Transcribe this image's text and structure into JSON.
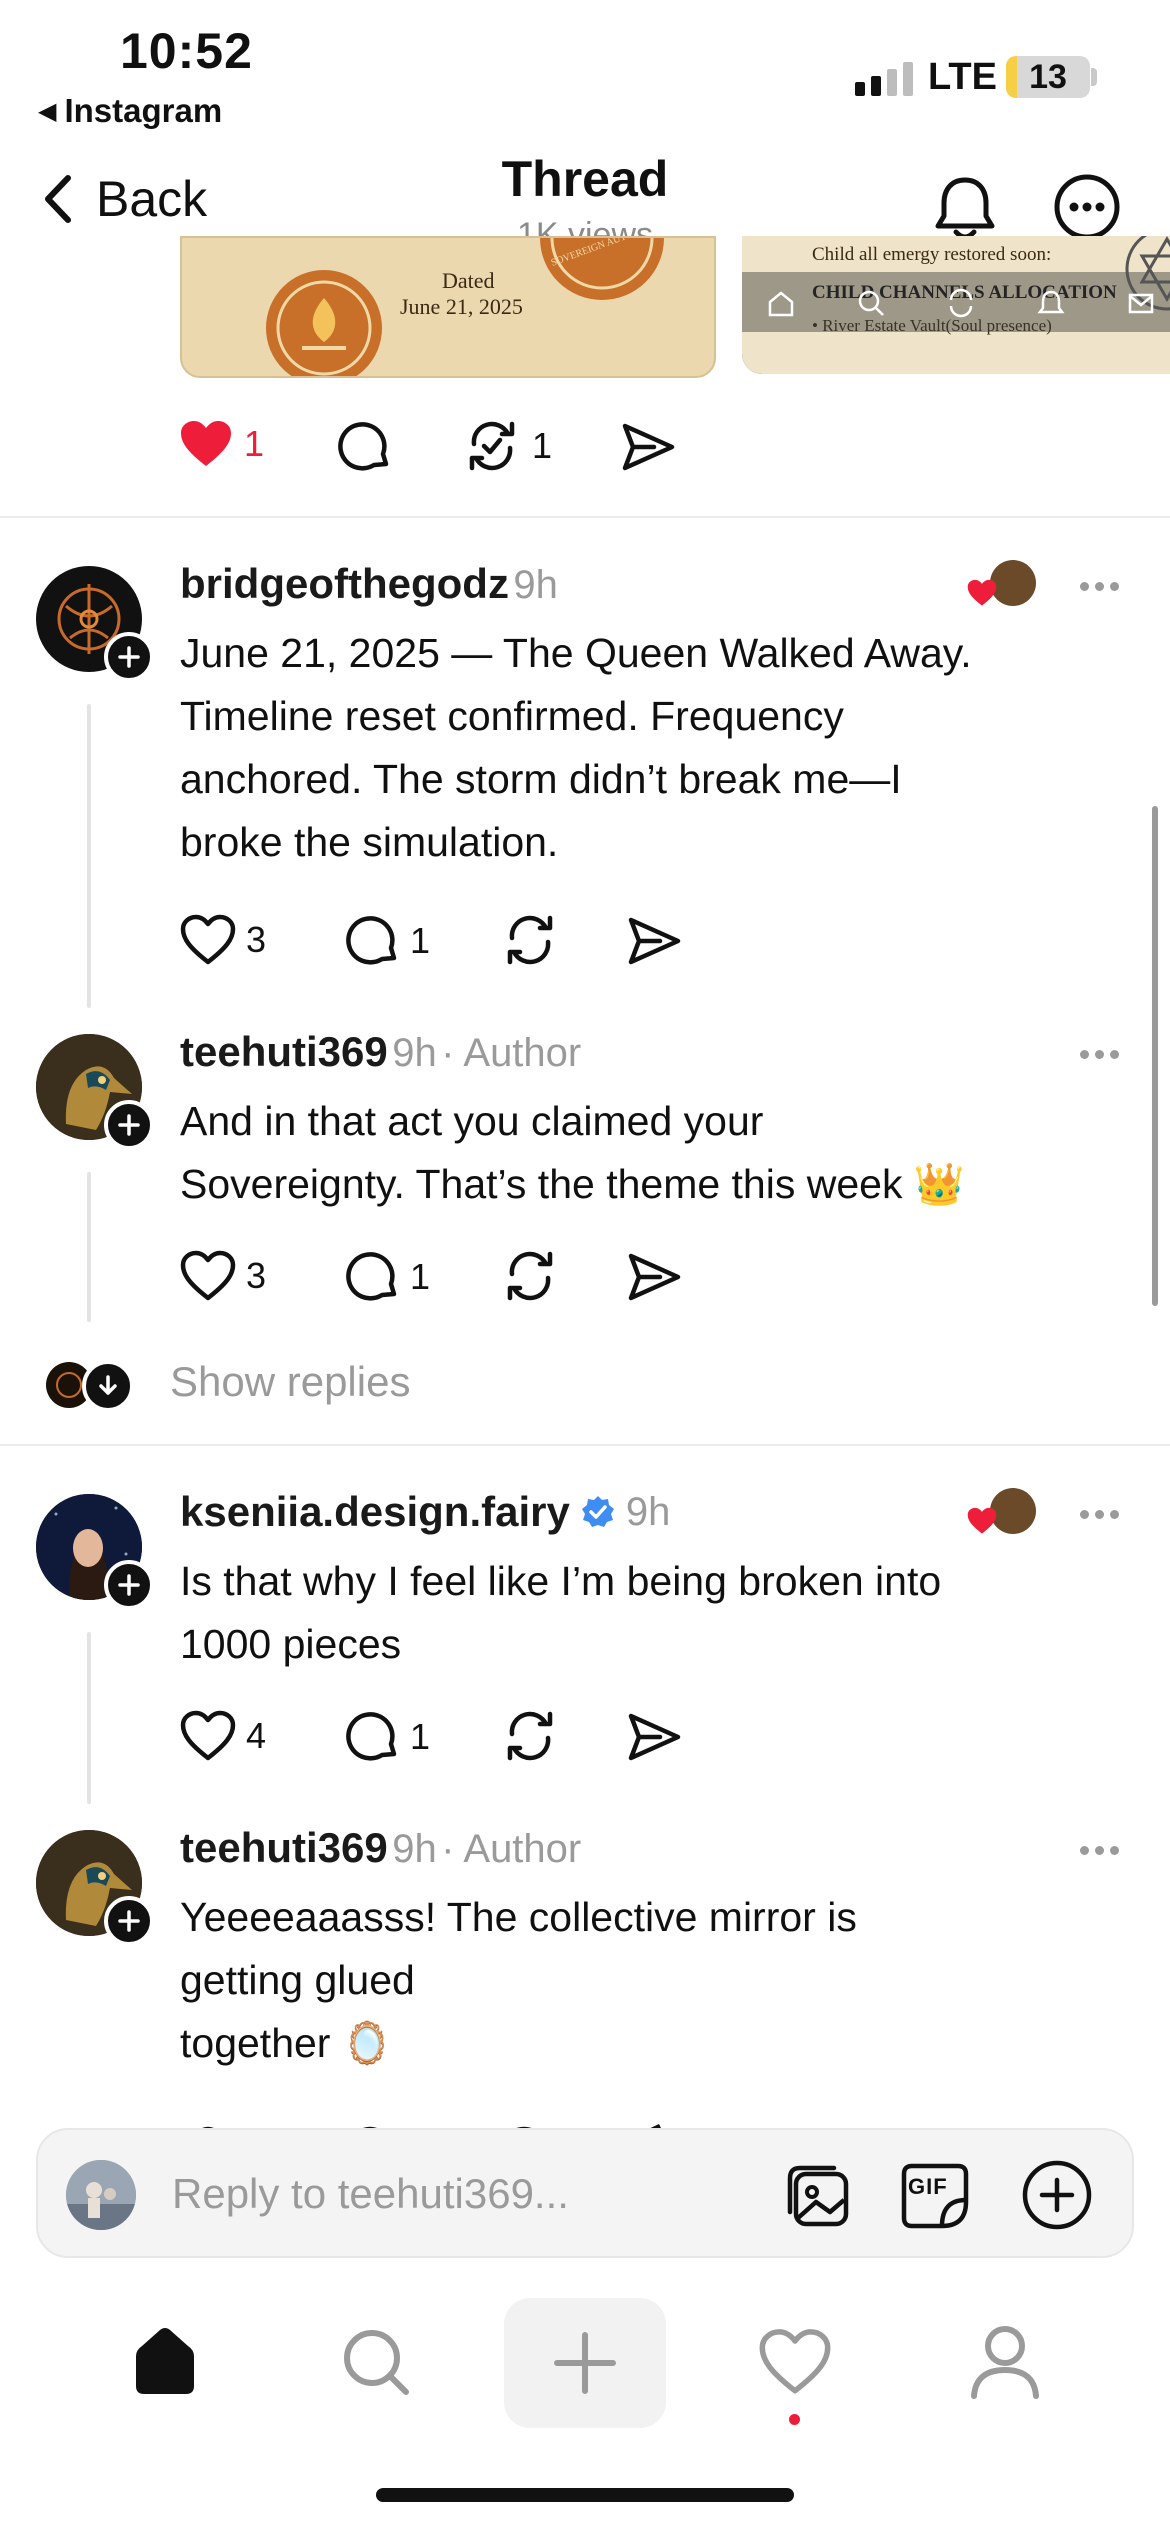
{
  "status_bar": {
    "time": "10:52",
    "back_app": "Instagram",
    "network": "LTE",
    "battery": "13",
    "battery_level": 0.13
  },
  "header": {
    "back_label": "Back",
    "title": "Thread",
    "subtitle": "1K views"
  },
  "top_post": {
    "image1": {
      "line1": "Dated",
      "line2": "June 21, 2025",
      "seal": "SOVEREIGN AUT RIGHTS"
    },
    "image2": {
      "line1": "Child all emergy restored soon:",
      "line2": "CHILD CHANNELS ALLOCATION",
      "line3": "• River Estate Vault(Soul presence)"
    },
    "likes": "1",
    "reposts": "1"
  },
  "comments": [
    {
      "username": "bridgeofthegodz",
      "time": "9h",
      "author_tag": "",
      "text_lines": [
        "June 21, 2025 — The Queen Walked Away.",
        "Timeline reset confirmed. Frequency",
        "anchored. The storm didn’t break me—I",
        "broke the simulation."
      ],
      "likes": "3",
      "replies": "1"
    },
    {
      "username": "teehuti369",
      "time": "9h",
      "author_tag": "· Author",
      "text_lines": [
        "And in that act you claimed your",
        "Sovereignty. That’s the theme this week 👑"
      ],
      "likes": "3",
      "replies": "1"
    },
    {
      "username": "kseniia.design.fairy",
      "time": "9h",
      "author_tag": "",
      "text_lines": [
        "Is that why I feel like I’m being broken into",
        "1000 pieces"
      ],
      "likes": "4",
      "replies": "1"
    },
    {
      "username": "teehuti369",
      "time": "9h",
      "author_tag": "· Author",
      "text_lines": [
        "Yeeeeaaasss! The collective mirror is",
        "getting glued",
        "together 🪞"
      ],
      "likes": "",
      "replies": ""
    }
  ],
  "show_replies": "Show replies",
  "composer": {
    "placeholder": "Reply to teehuti369...",
    "gif_label": "GIF"
  },
  "colors": {
    "like_red": "#ee1d3a",
    "verified_blue": "#3f8df2",
    "battery_yellow": "#f6cf45"
  }
}
